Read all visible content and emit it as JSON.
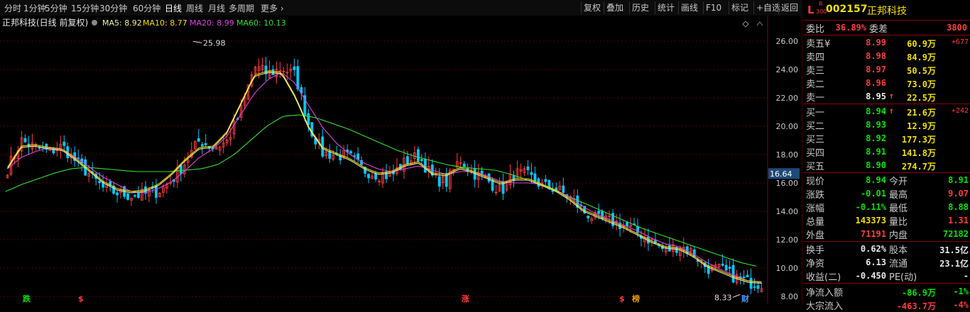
{
  "toolbar": {
    "periods": [
      "分时",
      "1分钟",
      "5分钟",
      "15分钟",
      "30分钟",
      "60分钟",
      "日线",
      "周线",
      "月线",
      "多周期",
      "更多"
    ],
    "active_period": "日线",
    "tools": [
      "复权",
      "叠加",
      "历史",
      "统计",
      "画线",
      "F10",
      "标记",
      "+自选",
      "返回"
    ]
  },
  "legend": {
    "title": "正邦科技(日线 前复权)",
    "ma5": "MA5: 8.92",
    "ma10": "MA10: 8.77",
    "ma20": "MA20: 8.99",
    "ma60": "MA60: 10.13",
    "ma5_color": "#f0f0a0",
    "ma10_color": "#f0e000",
    "ma20_color": "#e040e0",
    "ma60_color": "#30e030"
  },
  "chart_data": {
    "type": "candlestick",
    "y_ticks": [
      "26.00",
      "24.00",
      "22.00",
      "20.00",
      "18.00",
      "16.00",
      "14.00",
      "12.00",
      "10.00",
      "8.00"
    ],
    "ylim": [
      8.0,
      26.8
    ],
    "price_marker": "16.64",
    "high_label": "25.98",
    "low_label": "8.33",
    "close_path": [
      17.0,
      19.0,
      18.5,
      18.2,
      18.6,
      17.5,
      16.6,
      15.6,
      15.3,
      15.1,
      15.2,
      15.4,
      16.2,
      17.5,
      19.0,
      18.5,
      18.9,
      21.0,
      24.2,
      23.7,
      24.1,
      23.6,
      20.0,
      18.1,
      18.0,
      17.8,
      16.9,
      16.6,
      16.5,
      17.5,
      17.9,
      16.4,
      16.0,
      17.7,
      16.7,
      16.2,
      15.4,
      16.7,
      16.5,
      15.8,
      15.6,
      15.0,
      14.0,
      13.4,
      13.3,
      13.0,
      12.5,
      11.9,
      11.2,
      11.6,
      11.1,
      10.0,
      9.9,
      9.4,
      9.0,
      8.91
    ],
    "ma5_path": [
      17.0,
      18.5,
      18.6,
      18.4,
      18.3,
      17.6,
      16.8,
      16.0,
      15.5,
      15.3,
      15.4,
      15.8,
      16.6,
      17.6,
      18.4,
      18.5,
      19.5,
      21.5,
      23.5,
      23.8,
      23.7,
      22.0,
      19.8,
      18.4,
      18.0,
      17.6,
      17.0,
      16.6,
      16.7,
      17.2,
      17.4,
      16.6,
      16.5,
      17.0,
      16.7,
      16.3,
      15.9,
      16.2,
      16.2,
      15.8,
      15.4,
      14.8,
      14.0,
      13.6,
      13.2,
      12.8,
      12.3,
      11.8,
      11.4,
      11.3,
      10.8,
      10.1,
      9.7,
      9.3,
      9.0,
      8.92
    ],
    "ma20_path": [
      17.0,
      17.8,
      18.2,
      18.5,
      18.3,
      17.8,
      17.1,
      16.4,
      15.9,
      15.4,
      15.3,
      15.6,
      16.1,
      16.9,
      17.8,
      18.4,
      19.3,
      20.8,
      22.3,
      23.3,
      23.8,
      23.0,
      21.4,
      19.9,
      18.8,
      18.0,
      17.4,
      17.0,
      16.8,
      17.0,
      17.2,
      16.9,
      16.6,
      16.8,
      16.8,
      16.5,
      16.1,
      16.0,
      16.0,
      15.9,
      15.5,
      15.0,
      14.3,
      13.8,
      13.4,
      13.0,
      12.6,
      12.1,
      11.7,
      11.5,
      11.0,
      10.4,
      9.9,
      9.5,
      9.1,
      8.99
    ],
    "ma60_path": [
      15.4,
      15.9,
      16.3,
      16.7,
      17.0,
      17.1,
      17.0,
      16.9,
      16.8,
      16.8,
      16.8,
      16.9,
      17.0,
      17.3,
      18.0,
      19.0,
      20.0,
      20.7,
      20.8,
      20.6,
      20.2,
      19.8,
      19.3,
      18.8,
      18.3,
      17.9,
      17.6,
      17.3,
      17.1,
      17.0,
      16.9,
      16.6,
      16.2,
      15.8,
      15.3,
      14.8,
      14.3,
      13.8,
      13.3,
      12.8,
      12.4,
      12.0,
      11.6,
      11.2,
      10.8,
      10.4,
      10.13
    ],
    "markers": [
      {
        "label": "跌",
        "color": "#00e600"
      },
      {
        "label": "$",
        "color": "#ff3c3c"
      },
      {
        "label": "涨",
        "color": "#ff3c3c"
      },
      {
        "label": "$",
        "color": "#ff3c3c"
      },
      {
        "label": "榜",
        "color": "#f0a000"
      },
      {
        "label": "财",
        "color": "#3ca0ff"
      }
    ]
  },
  "quote": {
    "code": "002157",
    "name": "正邦科技",
    "prefix": "L",
    "tag_top": "R",
    "tag_bottom": "300",
    "weibi_label": "委比",
    "weibi": "36.89%",
    "weicha_label": "委差",
    "weicha": "3800",
    "sell": [
      {
        "label": "卖五",
        "mark": "¥",
        "price": "8.99",
        "vol": "60.9万",
        "change": "+677"
      },
      {
        "label": "卖四",
        "mark": "",
        "price": "8.98",
        "vol": "84.9万",
        "change": ""
      },
      {
        "label": "卖三",
        "mark": "",
        "price": "8.97",
        "vol": "50.5万",
        "change": ""
      },
      {
        "label": "卖二",
        "mark": "",
        "price": "8.96",
        "vol": "73.0万",
        "change": ""
      },
      {
        "label": "卖一",
        "mark": "",
        "price": "8.95",
        "vol": "22.5万",
        "change": "",
        "arrow": "↑"
      }
    ],
    "buy": [
      {
        "label": "买一",
        "price": "8.94",
        "vol": "21.6万",
        "change": "+242",
        "arrow": "↑"
      },
      {
        "label": "买二",
        "price": "8.93",
        "vol": "12.9万",
        "change": ""
      },
      {
        "label": "买三",
        "price": "8.92",
        "vol": "177.3万",
        "change": ""
      },
      {
        "label": "买四",
        "price": "8.91",
        "vol": "141.8万",
        "change": ""
      },
      {
        "label": "买五",
        "price": "8.90",
        "vol": "274.7万",
        "change": ""
      }
    ],
    "stats": [
      {
        "l1": "现价",
        "v1": "8.94",
        "c1": "green",
        "l2": "今开",
        "v2": "8.91",
        "c2": "green"
      },
      {
        "l1": "涨跌",
        "v1": "-0.01",
        "c1": "green",
        "l2": "最高",
        "v2": "9.07",
        "c2": "red"
      },
      {
        "l1": "涨幅",
        "v1": "-0.11%",
        "c1": "green",
        "l2": "最低",
        "v2": "8.88",
        "c2": "green"
      },
      {
        "l1": "总量",
        "v1": "143373",
        "c1": "yellow",
        "l2": "量比",
        "v2": "1.31",
        "c2": "red"
      },
      {
        "l1": "外盘",
        "v1": "71191",
        "c1": "red",
        "l2": "内盘",
        "v2": "72182",
        "c2": "green"
      }
    ],
    "stats2": [
      {
        "l1": "换手",
        "v1": "0.62%",
        "l2": "股本",
        "v2": "31.5亿"
      },
      {
        "l1": "净资",
        "v1": "6.13",
        "l2": "流通",
        "v2": "23.1亿"
      },
      {
        "l1": "收益(二)",
        "v1": "-0.450",
        "l2": "PE(动)",
        "v2": "-"
      }
    ],
    "flow_label": "净流入额",
    "flow_value": "-86.9万",
    "flow_pct": "-1%",
    "flow2_label": "大宗流入",
    "flow2_value": "-463.7万",
    "flow2_pct": "-4%"
  }
}
